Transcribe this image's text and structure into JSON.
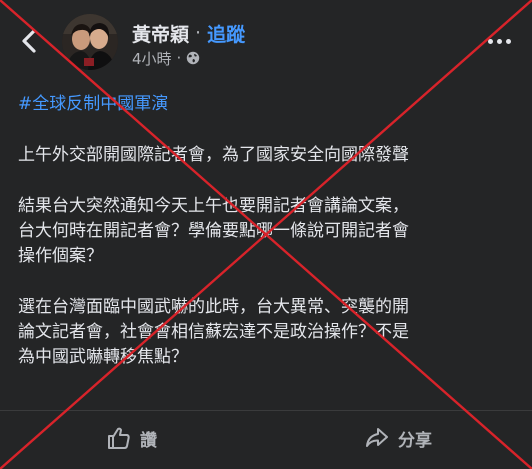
{
  "post": {
    "author": "黃帝穎",
    "separator": "·",
    "follow_label": "追蹤",
    "time": "4小時",
    "meta_separator": "·",
    "privacy_icon": "globe-icon",
    "hashtag": "#全球反制中國軍演",
    "paragraphs": [
      {
        "lines": [
          "上午外交部開國際記者會，為了國家安全向國際發聲"
        ]
      },
      {
        "lines": [
          "結果台大突然通知今天上午也要開記者會講論文案，",
          "台大何時在開記者會？學倫要點哪一條說可開記者會",
          "操作個案？"
        ]
      },
      {
        "lines": [
          "選在台灣面臨中國武嚇的此時，台大異常、突襲的開",
          "論文記者會，社會會相信蘇宏達不是政治操作？不是",
          "為中國武嚇轉移焦點？"
        ]
      }
    ]
  },
  "actions": {
    "like_label": "讚",
    "share_label": "分享"
  },
  "colors": {
    "background": "#242526",
    "text": "#e4e6eb",
    "link": "#4599ff",
    "secondary": "#b0b3b8",
    "cross": "#d8232a"
  }
}
